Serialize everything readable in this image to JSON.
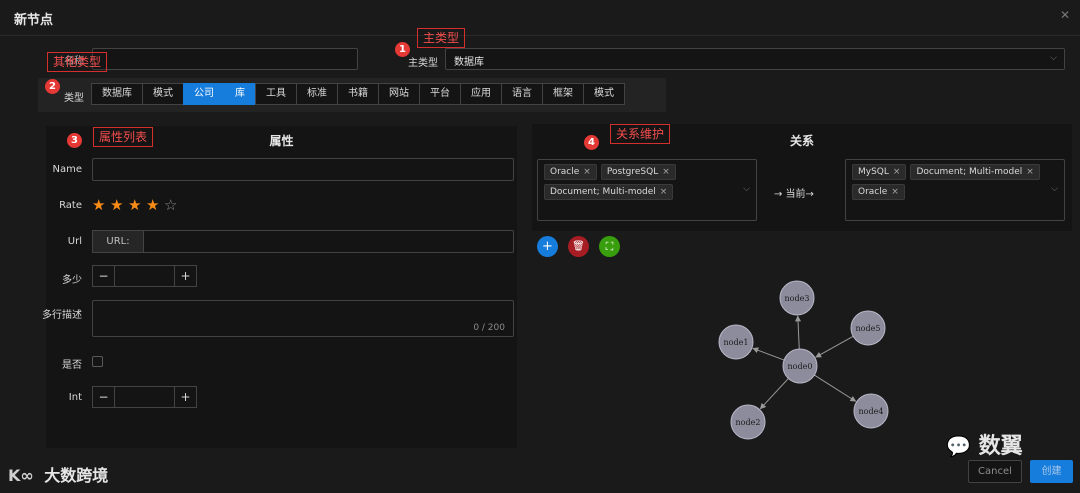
{
  "modal": {
    "title": "新节点"
  },
  "annotations": {
    "a1": "主类型",
    "a2": "其他类型",
    "a3": "属性列表",
    "a4": "关系维护",
    "n1": "1",
    "n2": "2",
    "n3": "3",
    "n4": "4"
  },
  "form": {
    "name_label": "名称",
    "main_type_label": "主类型",
    "main_type_value": "数据库",
    "type_label": "类型"
  },
  "type_tabs": [
    {
      "label": "数据库",
      "active": false
    },
    {
      "label": "模式",
      "active": false
    },
    {
      "label": "公司",
      "active": true
    },
    {
      "label": "库",
      "active": true
    },
    {
      "label": "工具",
      "active": false
    },
    {
      "label": "标准",
      "active": false
    },
    {
      "label": "书籍",
      "active": false
    },
    {
      "label": "网站",
      "active": false
    },
    {
      "label": "平台",
      "active": false
    },
    {
      "label": "应用",
      "active": false
    },
    {
      "label": "语言",
      "active": false
    },
    {
      "label": "框架",
      "active": false
    },
    {
      "label": "模式",
      "active": false
    }
  ],
  "attributes": {
    "title": "属性",
    "name_label": "Name",
    "rate_label": "Rate",
    "rate_value": 4,
    "rate_max": 5,
    "url_label": "Url",
    "url_addon": "URL:",
    "count_label": "多少",
    "minus": "−",
    "plus": "+",
    "desc_label": "多行描述",
    "desc_counter": "0 / 200",
    "bool_label": "是否",
    "int_label": "Int"
  },
  "relations": {
    "title": "关系",
    "left_tags": [
      "Oracle",
      "PostgreSQL",
      "Document; Multi-model"
    ],
    "middle": "→ 当前→",
    "right_tags": [
      "MySQL",
      "Document; Multi-model",
      "Oracle"
    ],
    "add_icon": "+",
    "delete_icon": "🗑",
    "expand_icon": "⛶"
  },
  "graph": {
    "nodes": [
      {
        "id": "node0"
      },
      {
        "id": "node1"
      },
      {
        "id": "node2"
      },
      {
        "id": "node3"
      },
      {
        "id": "node4"
      },
      {
        "id": "node5"
      }
    ],
    "edges": [
      [
        "node0",
        "node1"
      ],
      [
        "node0",
        "node2"
      ],
      [
        "node0",
        "node3"
      ],
      [
        "node0",
        "node4"
      ],
      [
        "node5",
        "node0"
      ]
    ]
  },
  "footer": {
    "cancel": "Cancel",
    "create": "创建"
  },
  "watermarks": {
    "left": "大数跨境",
    "right": "数翼"
  },
  "colors": {
    "accent": "#177ddc",
    "annotation": "#e53935",
    "star": "#fa8c16",
    "node_fill": "#8c8c9c",
    "add_button": "#177ddc",
    "delete_button": "#a61d24",
    "expand_button": "#389e0d"
  }
}
